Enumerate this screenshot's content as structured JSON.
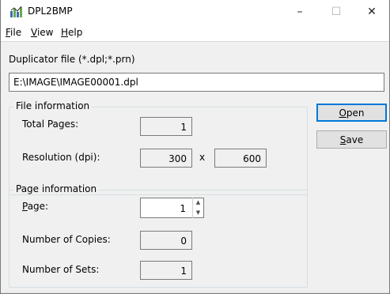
{
  "window": {
    "title": "DPL2BMP",
    "minimize_glyph": "–",
    "maximize_glyph": "☐",
    "close_glyph": "✕"
  },
  "menu": [
    {
      "accel": "F",
      "rest": "ile"
    },
    {
      "accel": "V",
      "rest": "iew"
    },
    {
      "accel": "H",
      "rest": "elp"
    }
  ],
  "duplicator_file": {
    "label": "Duplicator file (*.dpl;*.prn)",
    "value": "E:\\IMAGE\\IMAGE00001.dpl"
  },
  "file_info": {
    "legend": "File information",
    "total_pages_label": "Total Pages:",
    "total_pages_value": "1",
    "resolution_label": "Resolution (dpi):",
    "resolution_x": "300",
    "resolution_sep": "x",
    "resolution_y": "600"
  },
  "page_info": {
    "legend": "Page information",
    "page_label_accel": "P",
    "page_label_rest": "age:",
    "page_value": "1",
    "copies_label": "Number of Copies:",
    "copies_value": "0",
    "sets_label": "Number of Sets:",
    "sets_value": "1"
  },
  "buttons": {
    "open_accel": "O",
    "open_rest": "pen",
    "save_accel": "S",
    "save_rest": "ave"
  },
  "icons": {
    "app": "app-icon",
    "spin_up": "spin-up-arrow-icon",
    "spin_down": "spin-down-arrow-icon"
  },
  "colors": {
    "default_button_border": "#0078d7",
    "client_background": "#f0f0f0"
  }
}
